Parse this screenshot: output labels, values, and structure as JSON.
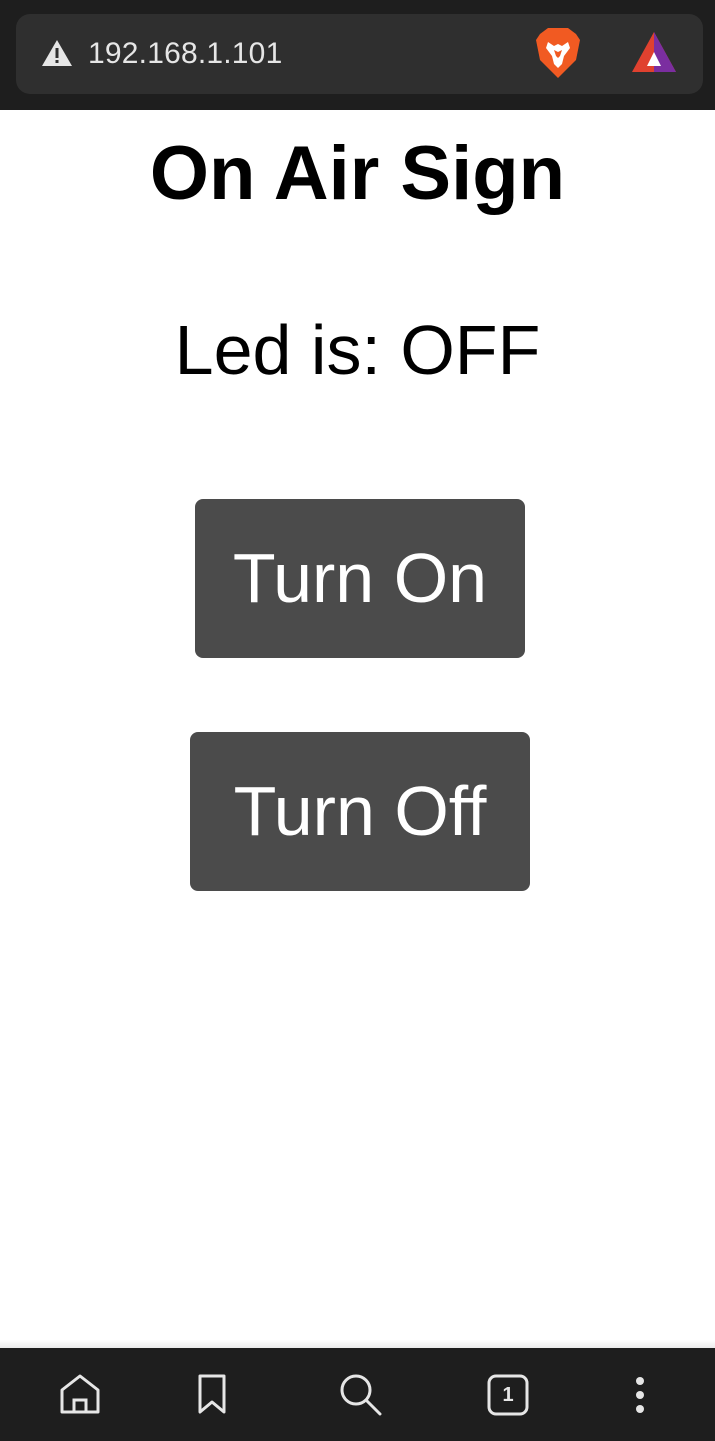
{
  "browser": {
    "url": "192.168.1.101",
    "icons": {
      "security": "warning-triangle-icon",
      "shields": "brave-lion-icon",
      "rewards": "brave-rewards-icon"
    }
  },
  "page": {
    "title": "On Air Sign",
    "status": "Led is: OFF",
    "buttons": {
      "on_label": "Turn On",
      "off_label": "Turn Off"
    },
    "colors": {
      "button_bg": "#4b4b4b",
      "button_text": "#ffffff"
    }
  },
  "bottom_nav": {
    "tab_count": "1",
    "icons": [
      "home-icon",
      "bookmark-icon",
      "search-icon",
      "tabs-icon",
      "more-icon"
    ]
  }
}
